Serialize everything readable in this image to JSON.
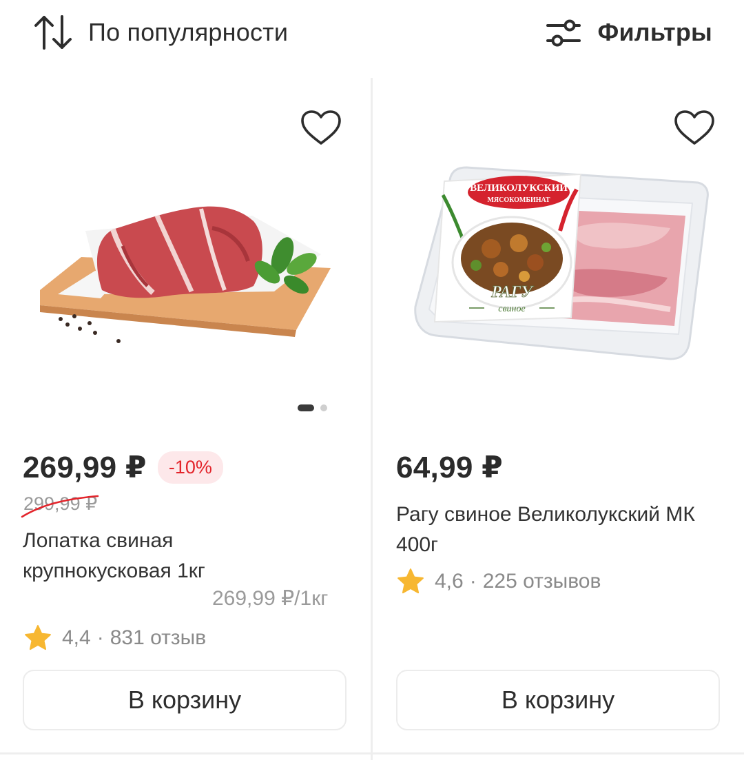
{
  "toolbar": {
    "sort_icon": "sort-arrows-icon",
    "sort_label": "По популярности",
    "filters_icon": "sliders-icon",
    "filters_label": "Фильтры"
  },
  "colors": {
    "discount_text": "#e3242b",
    "discount_bg": "#fde8ea",
    "star": "#f7b731",
    "text": "#2b2b2b",
    "muted": "#9a9a9a"
  },
  "products": [
    {
      "image": "pork-shoulder-on-board",
      "favorite_icon": "heart-outline-icon",
      "gallery_pages": 2,
      "gallery_active": 1,
      "price": "269,99 ₽",
      "discount": "-10%",
      "old_price": "299,99 ₽",
      "title": "Лопатка свиная крупнокусковая 1кг",
      "unit_price": "269,99 ₽/1кг",
      "rating": "4,4",
      "reviews": "831 отзыв",
      "cart_label": "В корзину"
    },
    {
      "image": "pork-ragout-tray",
      "favorite_icon": "heart-outline-icon",
      "price": "64,99 ₽",
      "title": "Рагу свиное Великолукский МК 400г",
      "rating": "4,6",
      "reviews": "225 отзывов",
      "cart_label": "В корзину",
      "package_text": {
        "brand": "ВЕЛИКОЛУКСКИЙ",
        "brand_sub": "МЯСОКОМБИНАТ",
        "name": "РАГУ",
        "name_sub": "свиное"
      }
    }
  ]
}
